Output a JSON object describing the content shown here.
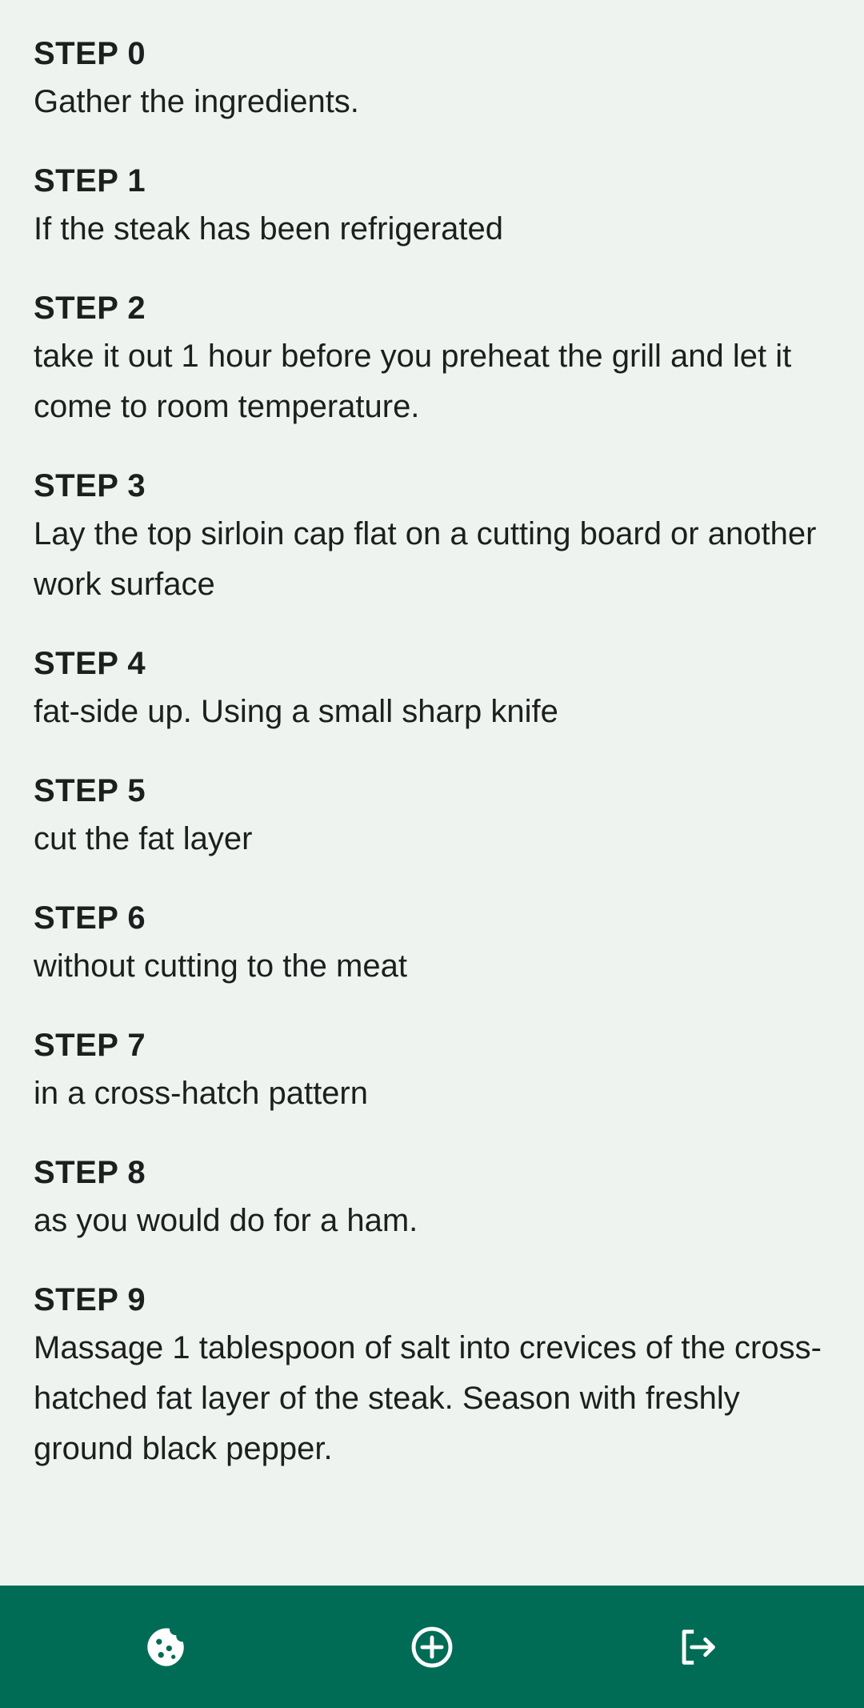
{
  "steps": [
    {
      "title": "STEP 0",
      "text": "Gather the ingredients."
    },
    {
      "title": "STEP 1",
      "text": "If the steak has been refrigerated"
    },
    {
      "title": "STEP 2",
      "text": "take it out 1 hour before you preheat the grill and let it come to room temperature."
    },
    {
      "title": "STEP 3",
      "text": "Lay the top sirloin cap flat on a cutting board or another work surface"
    },
    {
      "title": "STEP 4",
      "text": "fat-side up. Using a small sharp knife"
    },
    {
      "title": "STEP 5",
      "text": "cut the fat layer"
    },
    {
      "title": "STEP 6",
      "text": "without cutting to the meat"
    },
    {
      "title": "STEP 7",
      "text": "in a cross-hatch pattern"
    },
    {
      "title": "STEP 8",
      "text": "as you would do for a ham."
    },
    {
      "title": "STEP 9",
      "text": "Massage 1 tablespoon of salt into crevices of the cross-hatched fat layer of the steak. Season with freshly ground black pepper."
    }
  ],
  "bottom_nav": {
    "items": [
      {
        "icon": "cookie-icon"
      },
      {
        "icon": "add-circle-icon"
      },
      {
        "icon": "logout-icon"
      }
    ],
    "background_color": "#006c56",
    "icon_color": "#ffffff"
  }
}
